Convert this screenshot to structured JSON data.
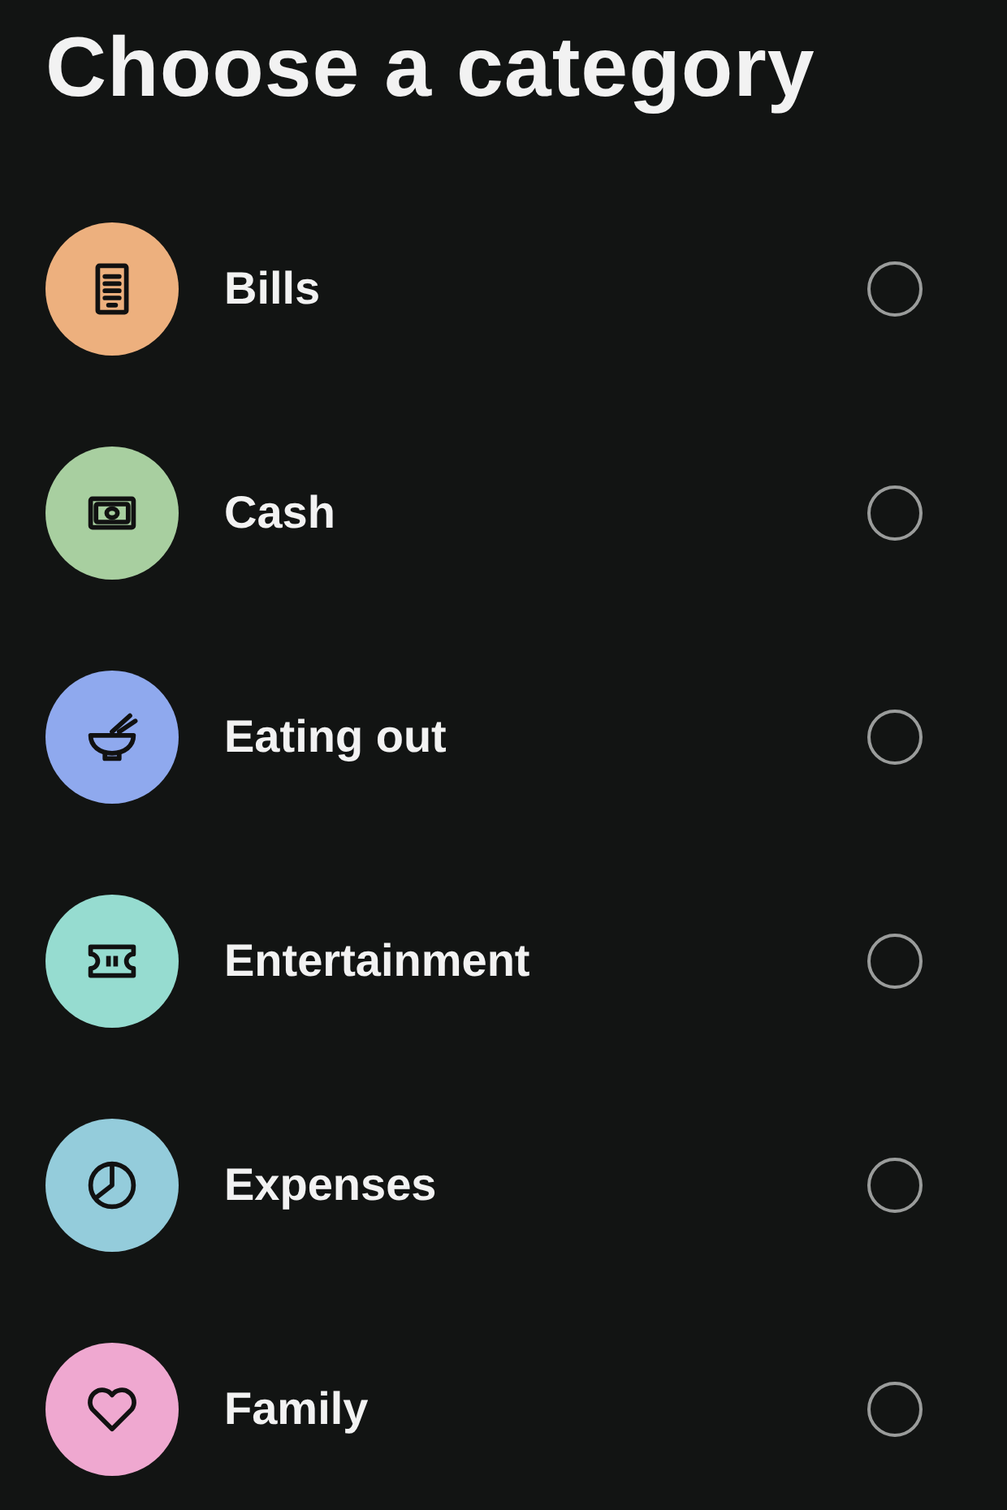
{
  "title": "Choose a category",
  "categories": [
    {
      "label": "Bills",
      "color": "#edb07e",
      "selected": false
    },
    {
      "label": "Cash",
      "color": "#a8cfa0",
      "selected": false
    },
    {
      "label": "Eating out",
      "color": "#8fa9ee",
      "selected": false
    },
    {
      "label": "Entertainment",
      "color": "#96dcd0",
      "selected": false
    },
    {
      "label": "Expenses",
      "color": "#94ccdb",
      "selected": false
    },
    {
      "label": "Family",
      "color": "#efa8d0",
      "selected": false
    }
  ]
}
